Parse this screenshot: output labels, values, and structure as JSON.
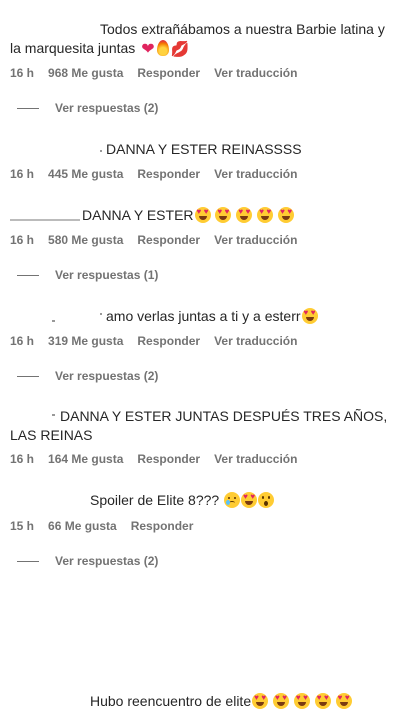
{
  "comments": [
    {
      "text1": "Todos extrañábamos a nuestra Barbie latina y",
      "text2": "la marquesita juntas",
      "time": "16 h",
      "likes": "968 Me gusta",
      "reply": "Responder",
      "translate": "Ver traducción",
      "replies": "Ver respuestas (2)"
    },
    {
      "text1": "DANNA Y ESTER REINASSSS",
      "time": "16 h",
      "likes": "445 Me gusta",
      "reply": "Responder",
      "translate": "Ver traducción"
    },
    {
      "text1": "DANNA Y ESTER",
      "time": "16 h",
      "likes": "580 Me gusta",
      "reply": "Responder",
      "translate": "Ver traducción",
      "replies": "Ver respuestas (1)"
    },
    {
      "text1": "amo verlas juntas a ti y a esterr",
      "time": "16 h",
      "likes": "319 Me gusta",
      "reply": "Responder",
      "translate": "Ver traducción",
      "replies": "Ver respuestas (2)"
    },
    {
      "text1": "DANNA Y ESTER JUNTAS DESPUÉS TRES AÑOS,",
      "text2": "LAS REINAS",
      "time": "16 h",
      "likes": "164 Me gusta",
      "reply": "Responder",
      "translate": "Ver traducción"
    },
    {
      "text1": "Spoiler de Elite 8???",
      "time": "15 h",
      "likes": "66 Me gusta",
      "reply": "Responder",
      "replies": "Ver respuestas (2)"
    },
    {
      "text1": "Hubo reencuentro de elite"
    }
  ]
}
